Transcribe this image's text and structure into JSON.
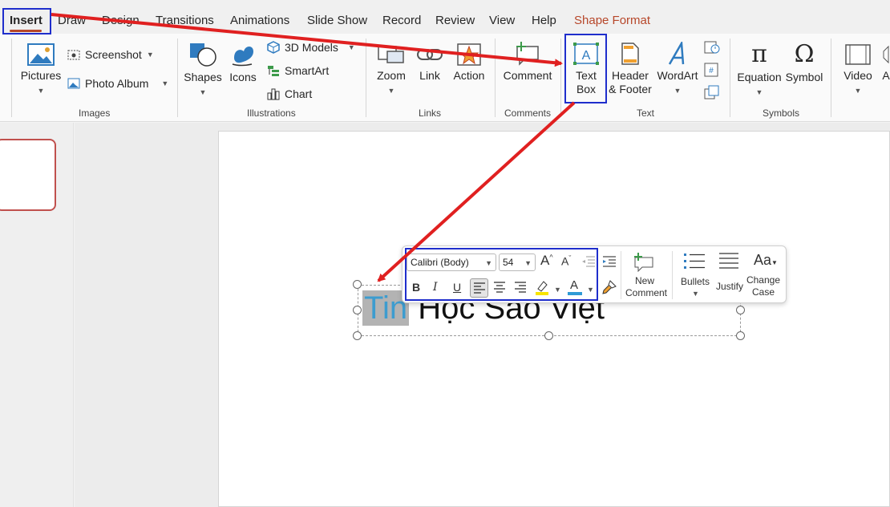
{
  "tabs": [
    {
      "label": "Insert",
      "active": true
    },
    {
      "label": "Draw"
    },
    {
      "label": "Design"
    },
    {
      "label": "Transitions"
    },
    {
      "label": "Animations"
    },
    {
      "label": "Slide Show"
    },
    {
      "label": "Record"
    },
    {
      "label": "Review"
    },
    {
      "label": "View"
    },
    {
      "label": "Help"
    },
    {
      "label": "Shape Format"
    }
  ],
  "ribbon": {
    "images": {
      "label": "Images",
      "pictures": "Pictures",
      "screenshot": "Screenshot",
      "photo_album": "Photo Album"
    },
    "illustrations": {
      "label": "Illustrations",
      "shapes": "Shapes",
      "icons": "Icons",
      "models": "3D Models",
      "smartart": "SmartArt",
      "chart": "Chart"
    },
    "links": {
      "label": "Links",
      "zoom": "Zoom",
      "link": "Link",
      "action": "Action"
    },
    "comments": {
      "label": "Comments",
      "comment": "Comment"
    },
    "text": {
      "label": "Text",
      "textbox_1": "Text",
      "textbox_2": "Box",
      "header_1": "Header",
      "header_2": "& Footer",
      "wordart": "WordArt"
    },
    "symbols": {
      "label": "Symbols",
      "equation": "Equation",
      "symbol": "Symbol"
    },
    "media": {
      "video": "Video",
      "audio": "A"
    }
  },
  "slide": {
    "text_selected": "Tin",
    "text_rest": " Học Sao Việt"
  },
  "mini_toolbar": {
    "font": "Calibri (Body)",
    "size": "54",
    "new_comment_1": "New",
    "new_comment_2": "Comment",
    "bullets": "Bullets",
    "justify": "Justify",
    "change_case_1": "Change",
    "change_case_2": "Case",
    "case_icon": "Aa"
  },
  "colors": {
    "accent": "#b7472a",
    "highlight_box": "#1f2ecc",
    "arrow": "#e02020",
    "selected_text": "#3d9ccf"
  }
}
